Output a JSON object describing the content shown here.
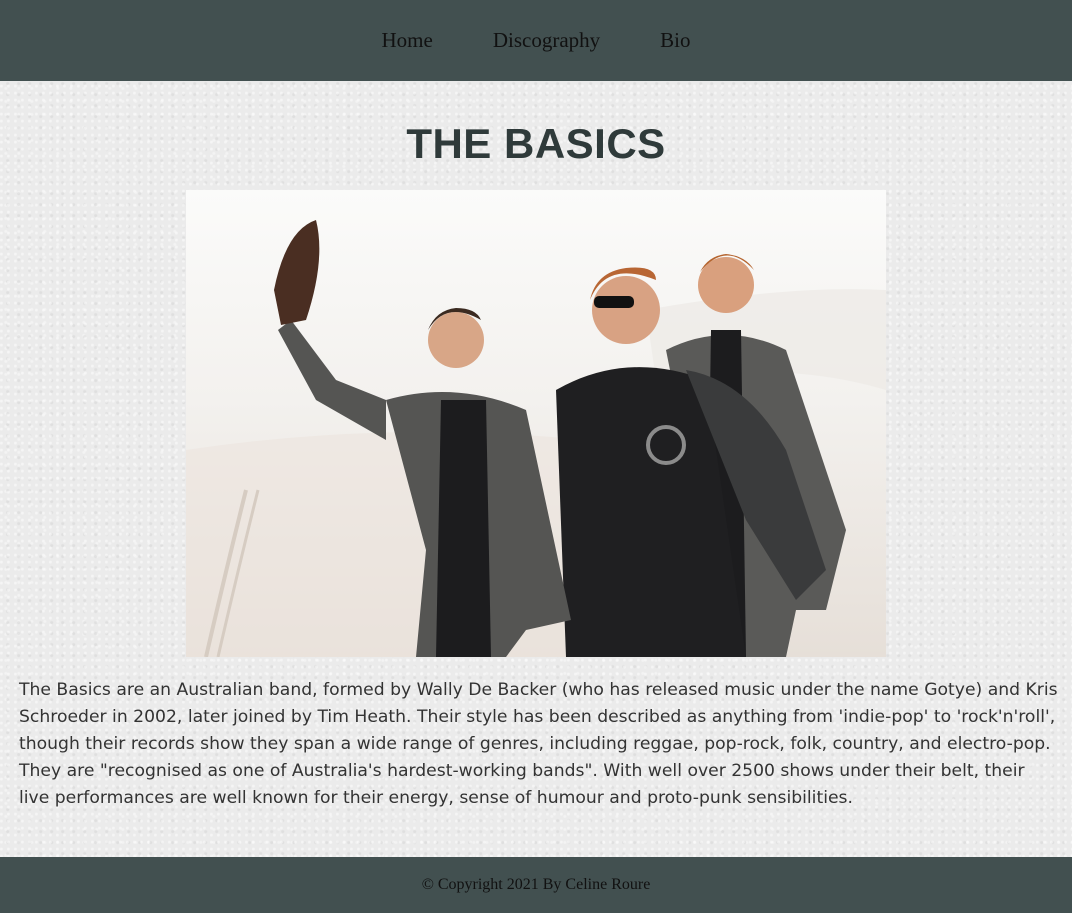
{
  "nav": {
    "items": [
      {
        "label": "Home"
      },
      {
        "label": "Discography"
      },
      {
        "label": "Bio"
      }
    ]
  },
  "main": {
    "title": "THE BASICS",
    "bio": "The Basics are an Australian band, formed by Wally De Backer (who has released music under the name Gotye) and Kris Schroeder in 2002, later joined by Tim Heath. Their style has been described as anything from 'indie-pop' to 'rock'n'roll', though their records show they span a wide range of genres, including reggae, pop-rock, folk, country, and electro-pop. They are \"recognised as one of Australia's hardest-working bands\". With well over 2500 shows under their belt, their live performances are well known for their energy, sense of humour and proto-punk sensibilities."
  },
  "footer": {
    "copyright": "© Copyright 2021 By Celine Roure"
  },
  "colors": {
    "nav_bg": "#425050",
    "page_bg": "#ebebeb",
    "title": "#2f3a3a",
    "text": "#333333"
  }
}
